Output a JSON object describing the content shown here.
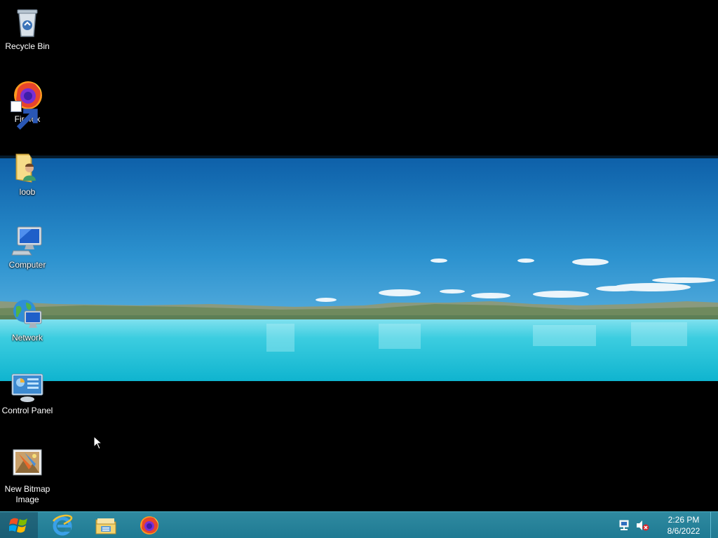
{
  "desktop": {
    "icons": [
      {
        "label": "Recycle Bin",
        "icon": "recycle-bin-icon"
      },
      {
        "label": "Firefox",
        "icon": "firefox-icon"
      },
      {
        "label": "loob",
        "icon": "user-folder-icon"
      },
      {
        "label": "Computer",
        "icon": "computer-icon"
      },
      {
        "label": "Network",
        "icon": "network-icon"
      },
      {
        "label": "Control Panel",
        "icon": "control-panel-icon"
      },
      {
        "label": "New Bitmap Image",
        "icon": "bitmap-image-icon"
      }
    ]
  },
  "taskbar": {
    "start": {
      "icon": "windows-logo-icon"
    },
    "pinned": [
      {
        "name": "Internet Explorer",
        "icon": "internet-explorer-icon"
      },
      {
        "name": "File Explorer",
        "icon": "file-explorer-icon"
      },
      {
        "name": "Firefox",
        "icon": "firefox-icon"
      }
    ],
    "tray": {
      "icons": [
        "network-tray-icon",
        "volume-muted-icon"
      ],
      "time": "2:26 PM",
      "date": "8/6/2022"
    }
  },
  "colors": {
    "taskbar": "#2683a0",
    "desktop_background": "#000000",
    "sky_top": "#1574ba",
    "water": "#2fc8dd"
  }
}
